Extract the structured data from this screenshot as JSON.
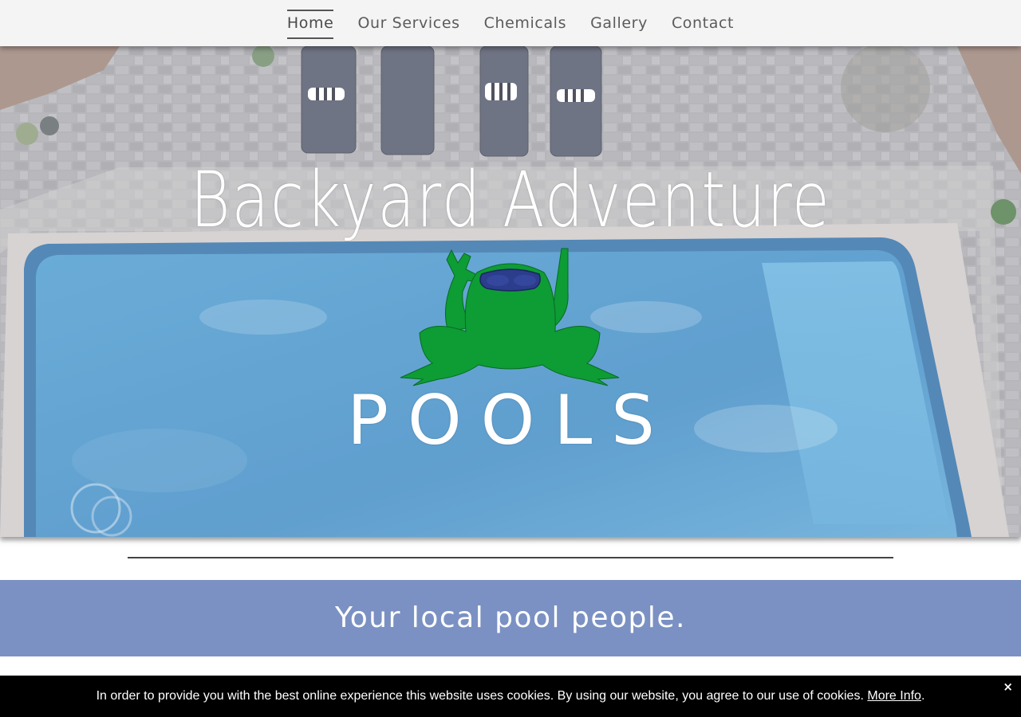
{
  "nav": {
    "items": [
      {
        "label": "Home",
        "active": true
      },
      {
        "label": "Our Services",
        "active": false
      },
      {
        "label": "Chemicals",
        "active": false
      },
      {
        "label": "Gallery",
        "active": false
      },
      {
        "label": "Contact",
        "active": false
      }
    ]
  },
  "hero": {
    "logo_title": "Backyard Adventure",
    "logo_subtitle": "POOLS",
    "frog_icon": "frog-with-goggles-icon"
  },
  "tagline": {
    "text": "Your local pool people."
  },
  "cookie": {
    "message": "In order to provide you with the best online experience this website uses cookies. By using our website, you agree to our use of cookies.",
    "link_label": "More Info",
    "trailing": ".",
    "close_label": "×"
  },
  "colors": {
    "nav_bg": "#f4f4f4",
    "tagline_bg": "#7b91c3",
    "pool_blue": "#3f8ec6",
    "frog_green": "#0e9c35",
    "goggles": "#2b3d8c",
    "cookie_bg": "#000000"
  }
}
